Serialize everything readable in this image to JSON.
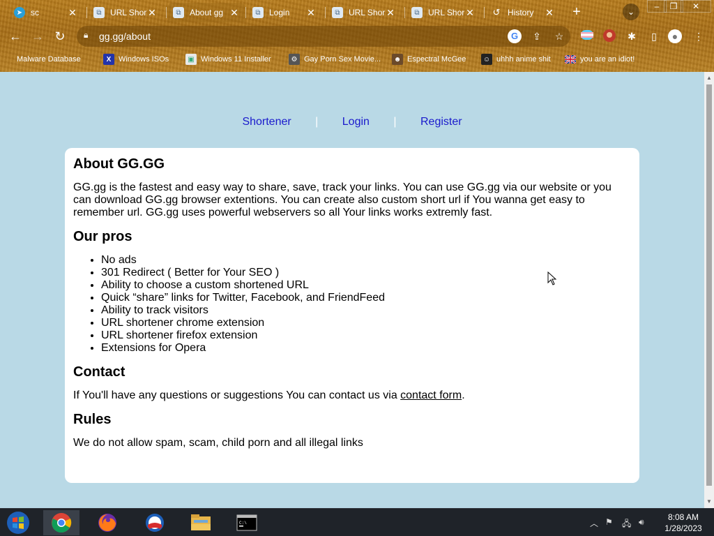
{
  "browser": {
    "tabs": [
      {
        "title": "sc",
        "icon": "telegram-icon"
      },
      {
        "title": "URL Short",
        "icon": "link-icon"
      },
      {
        "title": "About gg",
        "icon": "link-icon"
      },
      {
        "title": "Login",
        "icon": "link-icon"
      },
      {
        "title": "URL Short",
        "icon": "link-icon"
      },
      {
        "title": "URL Short",
        "icon": "link-icon"
      },
      {
        "title": "History",
        "icon": "history-icon"
      }
    ],
    "new_tab": "+",
    "url": "gg.gg/about",
    "bookmarks": [
      {
        "label": "Malware Database"
      },
      {
        "label": "Windows ISOs"
      },
      {
        "label": "Windows 11 Installer"
      },
      {
        "label": "Gay Porn Sex Movie..."
      },
      {
        "label": "Espectral McGee"
      },
      {
        "label": "uhhh anime shit"
      },
      {
        "label": "you are an idiot!"
      }
    ]
  },
  "page": {
    "nav": {
      "shortener": "Shortener",
      "sep1": "|",
      "login": "Login",
      "sep2": "|",
      "register": "Register"
    },
    "about_title": "About GG.GG",
    "about_text": "GG.gg is the fastest and easy way to share, save, track your links. You can use GG.gg via our website or you can download GG.gg browser extentions. You can create also custom short url if You wanna get easy to remember url. GG.gg uses powerful webservers so all Your links works extremly fast.",
    "pros_title": "Our pros",
    "pros": [
      "No ads",
      "301 Redirect ( Better for Your SEO )",
      "Ability to choose a custom shortened URL",
      "Quick “share” links for Twitter, Facebook, and FriendFeed",
      "Ability to track visitors",
      "URL shortener chrome extension",
      "URL shortener firefox extension",
      "Extensions for Opera"
    ],
    "contact_title": "Contact",
    "contact_text_before": "If You'll have any questions or suggestions You can contact us via ",
    "contact_link": "contact form",
    "contact_text_after": ".",
    "rules_title": "Rules",
    "rules_text": "We do not allow spam, scam, child porn and all illegal links"
  },
  "taskbar": {
    "apps": [
      "windows-start-icon",
      "chrome-icon",
      "firefox-icon",
      "obama-icon",
      "file-explorer-icon",
      "terminal-icon"
    ],
    "time": "8:08 AM",
    "date": "1/28/2023"
  }
}
